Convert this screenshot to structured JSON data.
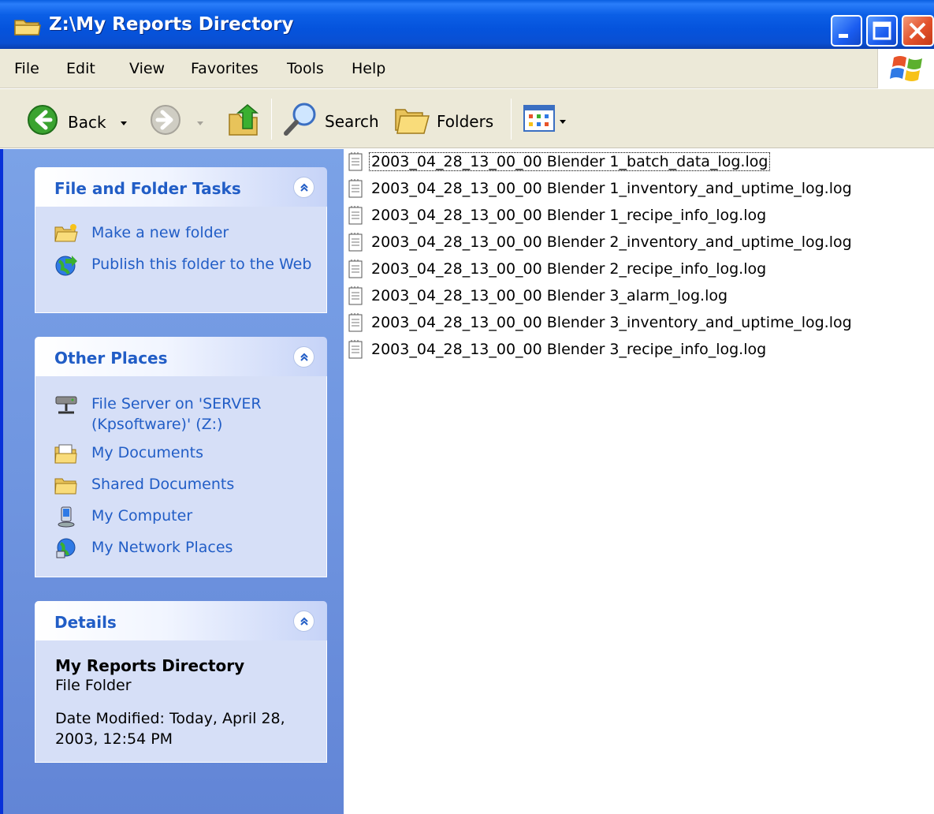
{
  "window": {
    "title": "Z:\\My Reports Directory"
  },
  "menu": [
    "File",
    "Edit",
    "View",
    "Favorites",
    "Tools",
    "Help"
  ],
  "toolbar": {
    "back_label": "Back",
    "search_label": "Search",
    "folders_label": "Folders"
  },
  "tasks_panel": {
    "title": "File and Folder Tasks",
    "items": [
      {
        "label": "Make a new folder",
        "icon": "new-folder-icon"
      },
      {
        "label": "Publish this folder to the Web",
        "icon": "publish-web-icon"
      }
    ]
  },
  "places_panel": {
    "title": "Other Places",
    "items": [
      {
        "label": "File Server on 'SERVER (Kpsoftware)' (Z:)",
        "icon": "network-drive-icon"
      },
      {
        "label": "My Documents",
        "icon": "my-documents-icon"
      },
      {
        "label": "Shared Documents",
        "icon": "folder-icon"
      },
      {
        "label": "My Computer",
        "icon": "my-computer-icon"
      },
      {
        "label": "My Network Places",
        "icon": "network-places-icon"
      }
    ]
  },
  "details_panel": {
    "title": "Details",
    "name": "My Reports Directory",
    "type": "File Folder",
    "date_modified": "Date Modified: Today, April 28, 2003, 12:54 PM"
  },
  "files": [
    "2003_04_28_13_00_00 Blender 1_batch_data_log.log",
    "2003_04_28_13_00_00 Blender 1_inventory_and_uptime_log.log",
    "2003_04_28_13_00_00 Blender 1_recipe_info_log.log",
    "2003_04_28_13_00_00 Blender 2_inventory_and_uptime_log.log",
    "2003_04_28_13_00_00 Blender 2_recipe_info_log.log",
    "2003_04_28_13_00_00 Blender 3_alarm_log.log",
    "2003_04_28_13_00_00 Blender 3_inventory_and_uptime_log.log",
    "2003_04_28_13_00_00 Blender 3_recipe_info_log.log"
  ]
}
